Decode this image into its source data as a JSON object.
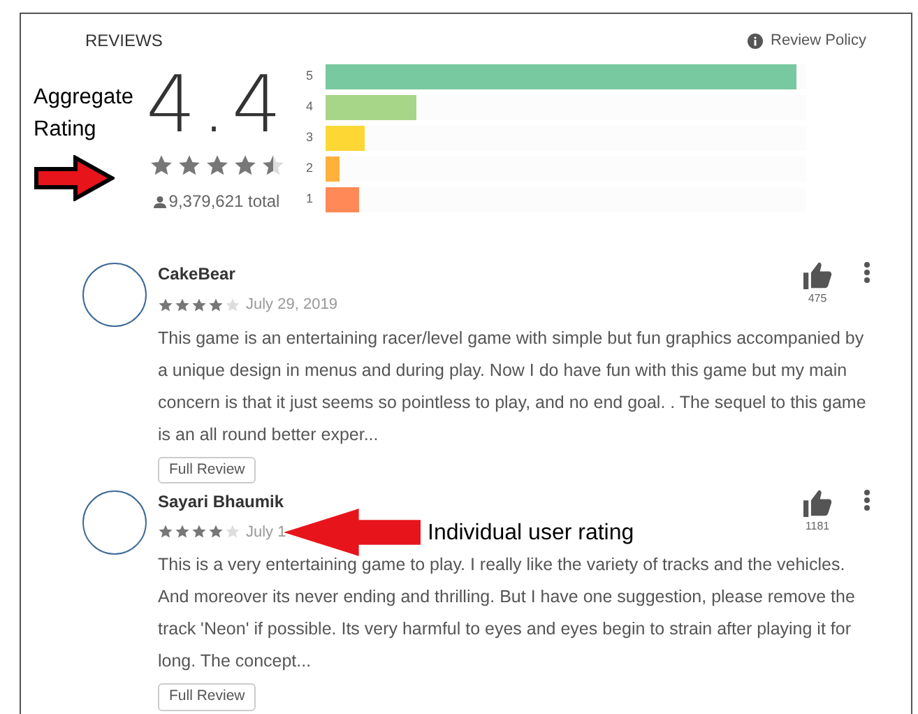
{
  "header": {
    "title": "REVIEWS",
    "policy_link": "Review Policy"
  },
  "summary": {
    "rating": "4.4",
    "stars": 4.5,
    "total": "9,379,621 total"
  },
  "histogram": [
    {
      "label": "5",
      "level": 0.98,
      "color": "#79c9a0"
    },
    {
      "label": "4",
      "level": 0.19,
      "color": "#a8d688"
    },
    {
      "label": "3",
      "level": 0.08,
      "color": "#fdd835"
    },
    {
      "label": "2",
      "level": 0.03,
      "color": "#ffb13b"
    },
    {
      "label": "1",
      "level": 0.07,
      "color": "#ff8a57"
    }
  ],
  "reviews": [
    {
      "author": "CakeBear",
      "stars": 4,
      "date": "July 29, 2019",
      "likes": "475",
      "text": "This game is an entertaining racer/level game with simple but fun graphics accompanied by a unique design in menus and during play. Now I do have fun with this game but my main concern is that it just seems so pointless to play, and no end goal. . The sequel to this game is an all round better exper...",
      "button": "Full Review"
    },
    {
      "author": "Sayari Bhaumik",
      "stars": 4,
      "date": "July 1",
      "likes": "1181",
      "text": "This is a very entertaining game to play. I really like the variety of tracks and the vehicles. And moreover its never ending and thrilling. But I have one suggestion, please remove the track 'Neon' if possible. Its very harmful to eyes and eyes begin to strain after playing it for long. The concept...",
      "button": "Full Review"
    }
  ],
  "annotations": [
    {
      "kind": "aggregate",
      "text": "Aggregate Rating"
    },
    {
      "kind": "individual",
      "text": "Individual user rating"
    }
  ]
}
